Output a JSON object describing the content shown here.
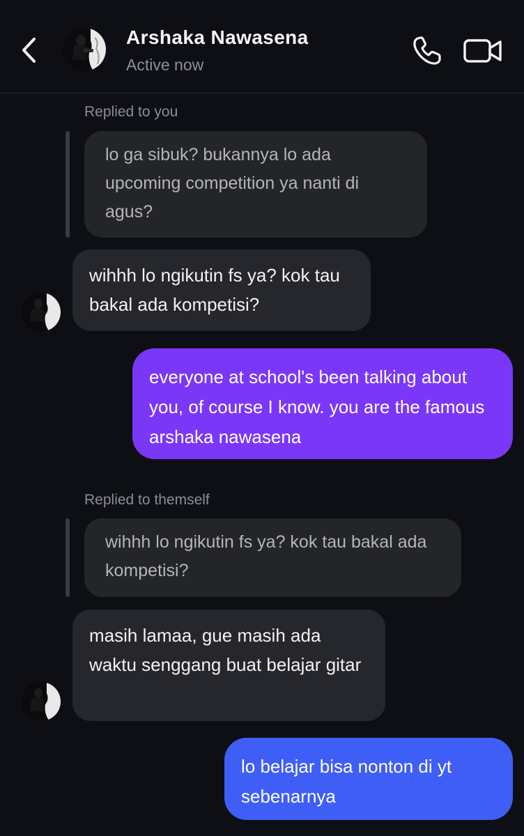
{
  "header": {
    "contact_name": "Arshaka Nawasena",
    "status": "Active now",
    "icons": {
      "back": "chevron-left-icon",
      "call": "phone-icon",
      "video": "video-camera-icon"
    }
  },
  "messages": [
    {
      "reply_label": "Replied to you",
      "quote": "lo ga sibuk? bukannya lo ada upcoming competition ya nanti di agus?"
    },
    {
      "sender": "them",
      "text": "wihhh lo ngikutin fs ya? kok tau bakal ada kompetisi?"
    },
    {
      "sender": "me",
      "text": "everyone at school's been talking about you, of course I know. you are the famous arshaka nawasena",
      "color": "#7a37f8"
    },
    {
      "reply_label": "Replied to themself",
      "quote": "wihhh lo ngikutin fs ya? kok tau bakal ada kompetisi?"
    },
    {
      "sender": "them",
      "text": "masih lamaa, gue masih ada waktu senggang buat belajar gitar"
    },
    {
      "sender": "me",
      "text": "lo belajar bisa nonton di yt sebenarnya",
      "color": "#3f5ef6"
    }
  ],
  "colors": {
    "background": "#0e0f14",
    "incoming_bubble": "#26272c",
    "quote_bubble": "#242528"
  }
}
